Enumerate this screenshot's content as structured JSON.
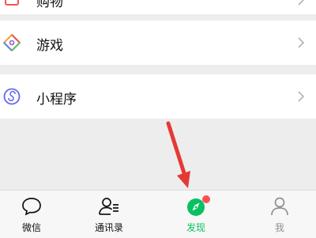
{
  "list": {
    "top_item": {
      "label": "购物",
      "icon": "shopping-bag-icon"
    },
    "games": {
      "label": "游戏",
      "icon": "games-diamond-icon"
    },
    "mini_programs": {
      "label": "小程序",
      "icon": "mini-program-icon"
    }
  },
  "tabbar": {
    "chats": {
      "label": "微信",
      "icon": "chat-bubble-icon"
    },
    "contacts": {
      "label": "通讯录",
      "icon": "contacts-icon"
    },
    "discover": {
      "label": "发现",
      "icon": "compass-icon",
      "badge": "red-dot"
    },
    "me": {
      "label": "我",
      "icon": "person-icon"
    }
  },
  "annotation": {
    "type": "arrow",
    "color": "#e53935",
    "target": "discover-tab"
  },
  "colors": {
    "active_green": "#07c160",
    "badge_red": "#fa5151",
    "arrow_red": "#e53935"
  }
}
